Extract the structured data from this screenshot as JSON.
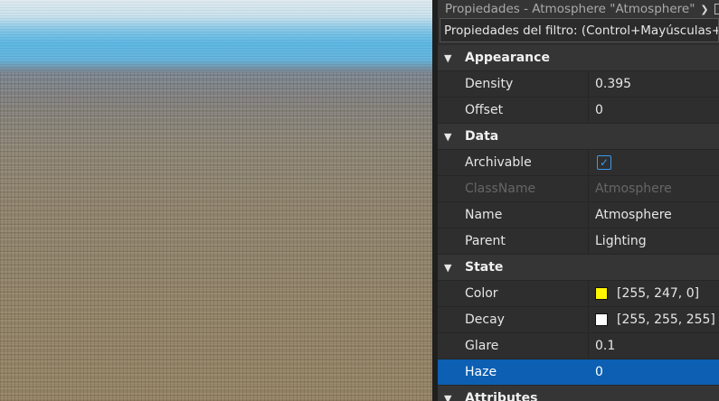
{
  "panel": {
    "title": "Propiedades - Atmosphere \"Atmosphere\"",
    "filter_placeholder": "Propiedades del filtro: (Control+Mayúsculas+P)"
  },
  "sections": [
    {
      "label": "Appearance",
      "rows": [
        {
          "name": "Density",
          "value": "0.395"
        },
        {
          "name": "Offset",
          "value": "0"
        }
      ]
    },
    {
      "label": "Data",
      "rows": [
        {
          "name": "Archivable",
          "value": "true"
        },
        {
          "name": "ClassName",
          "value": "Atmosphere"
        },
        {
          "name": "Name",
          "value": "Atmosphere"
        },
        {
          "name": "Parent",
          "value": "Lighting"
        }
      ]
    },
    {
      "label": "State",
      "rows": [
        {
          "name": "Color",
          "value": "[255, 247, 0]",
          "swatch": "#fff700"
        },
        {
          "name": "Decay",
          "value": "[255, 255, 255]",
          "swatch": "#ffffff"
        },
        {
          "name": "Glare",
          "value": "0.1"
        },
        {
          "name": "Haze",
          "value": "0"
        }
      ]
    },
    {
      "label": "Attributes",
      "rows": []
    }
  ],
  "colors": {
    "selection": "#0c5fb2",
    "checkbox": "#3a9bf0"
  }
}
